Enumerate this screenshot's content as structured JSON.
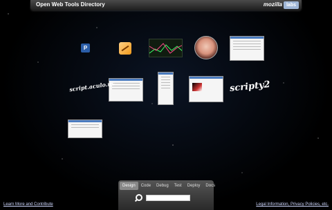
{
  "header": {
    "title": "Open Web Tools Directory",
    "brand": "mozilla",
    "brand_badge": "labs"
  },
  "tiles": {
    "p_icon_letter": "P",
    "script1_text": "script.aculo.us",
    "script2_text": "scripty2"
  },
  "panel": {
    "tabs": [
      "Design",
      "Code",
      "Debug",
      "Test",
      "Deploy",
      "Docs"
    ],
    "active_tab": "Design",
    "search_value": ""
  },
  "footer": {
    "left_link": "Learn More and Contribute",
    "right_link": "Legal Information, Privacy Policies, etc."
  },
  "colors": {
    "background": "#000000",
    "topbar": "#2e2e2e",
    "accent_blue": "#9fb6d6"
  }
}
